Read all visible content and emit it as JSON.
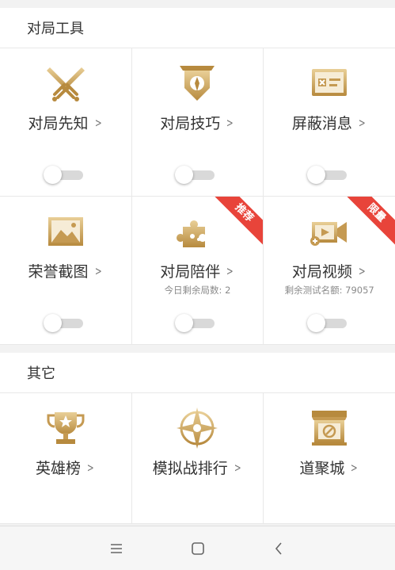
{
  "sections": {
    "match_tools": {
      "title": "对局工具",
      "items": [
        {
          "label": "对局先知",
          "icon": "crossed-swords-icon",
          "toggle": false
        },
        {
          "label": "对局技巧",
          "icon": "banner-shield-icon",
          "toggle": false
        },
        {
          "label": "屏蔽消息",
          "icon": "message-block-icon",
          "toggle": false
        },
        {
          "label": "荣誉截图",
          "icon": "image-icon",
          "toggle": false
        },
        {
          "label": "对局陪伴",
          "icon": "puzzle-icon",
          "sub": "今日剩余局数: 2",
          "badge": "推荐",
          "toggle": false
        },
        {
          "label": "对局视频",
          "icon": "video-camera-icon",
          "sub": "剩余测试名额: 79057",
          "badge": "限量",
          "toggle": false
        }
      ]
    },
    "other": {
      "title": "其它",
      "items": [
        {
          "label": "英雄榜",
          "icon": "trophy-icon"
        },
        {
          "label": "模拟战排行",
          "icon": "compass-star-icon"
        },
        {
          "label": "道聚城",
          "icon": "shop-icon"
        }
      ]
    }
  },
  "colors": {
    "gold_dark": "#b98b3c",
    "gold_light": "#e8c98a",
    "badge": "#e8443a"
  },
  "navbar": {
    "menu_icon": "menu-icon",
    "home_icon": "square-icon",
    "back_icon": "back-icon"
  }
}
